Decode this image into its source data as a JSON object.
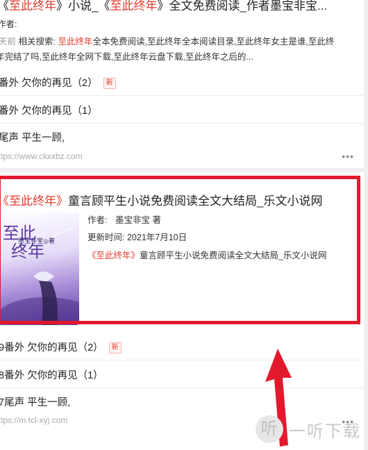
{
  "result1": {
    "title_pre": "《",
    "title_hl": "至此终年",
    "title_mid": "》小说_《",
    "title_hl2": "至此终年",
    "title_post": "》全文免费阅读_作者墨宝非宝...",
    "author_label": "作者:",
    "time": "天前",
    "related_label": "相关搜索:",
    "related_hl": "至此终年",
    "related_line1": "全本免费阅读,至此终年全本阅读目录,至此终年女主是谁,至此终",
    "related_line2": "年完结了吗,至此终年全网下载,至此终年云盘下载,至此终年之后的...",
    "chapters": [
      {
        "label": "番外 欠你的再见（2）",
        "badge": "新"
      },
      {
        "label": "番外 欠你的再见（1）",
        "badge": ""
      },
      {
        "label": "尾声 平生一顾,",
        "badge": ""
      }
    ],
    "url": "ttps://www.ckxxbz.com",
    "more": "•••"
  },
  "result2": {
    "title_hl": "《至此终年》",
    "title_rest": "童言顾平生小说免费阅读全文大结局_乐文小说网",
    "author_label": "作者:",
    "author_value": "墨宝非宝 著",
    "update_label": "更新时间:",
    "update_value": "2021年7月10日",
    "desc_hl": "《至此终年》",
    "desc_rest": "童言顾平生小说免费阅读全文大结局_乐文小说网",
    "cover_text_big": "至此",
    "cover_text_big2": "终年",
    "cover_text_small": "墨宝非宝◎著",
    "chapters": [
      {
        "label": "9番外 欠你的再见（2）",
        "badge": "新"
      },
      {
        "label": "8番外 欠你的再见（1）",
        "badge": ""
      },
      {
        "label": "7尾声 平生一顾,",
        "badge": ""
      }
    ],
    "url": "ttps://m.tcl-xyj.com",
    "more": "•••"
  },
  "watermark": {
    "glyph": "听",
    "text": "一听下载"
  },
  "colors": {
    "highlight": "#e23a2e",
    "annotation_red": "#e2192c"
  }
}
